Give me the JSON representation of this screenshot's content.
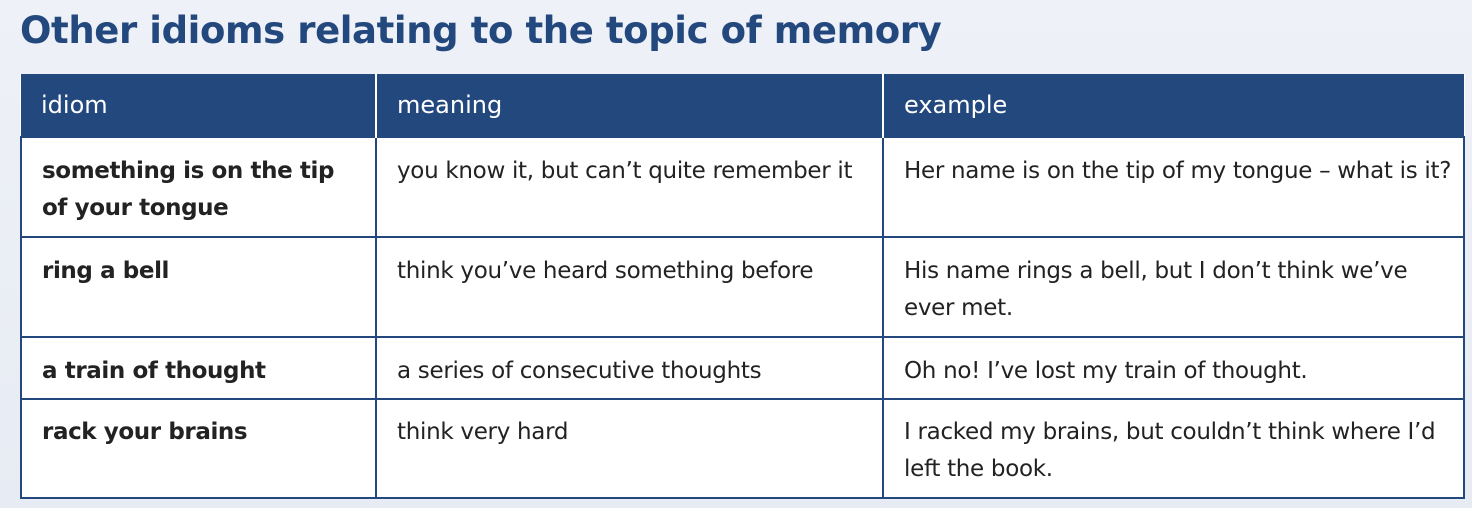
{
  "title": "Other idioms relating to the topic of memory",
  "table": {
    "headers": [
      "idiom",
      "meaning",
      "example"
    ],
    "rows": [
      {
        "idiom": "something is on the tip of your tongue",
        "meaning": "you know it, but can’t quite remember it",
        "example": "Her name is on the tip of my tongue – what is it?"
      },
      {
        "idiom": "ring a bell",
        "meaning": "think you’ve heard something before",
        "example": "His name rings a bell, but I don’t think we’ve ever met."
      },
      {
        "idiom": "a train of thought",
        "meaning": "a series of consecutive thoughts",
        "example": "Oh no! I’ve lost my train of thought."
      },
      {
        "idiom": "rack your brains",
        "meaning": "think very hard",
        "example": "I racked my brains, but couldn’t think where I’d left the book."
      }
    ]
  },
  "colors": {
    "heading": "#23487e",
    "header_background": "#23487e",
    "header_text": "#ffffff",
    "cell_background": "#ffffff",
    "border": "#23487e"
  }
}
